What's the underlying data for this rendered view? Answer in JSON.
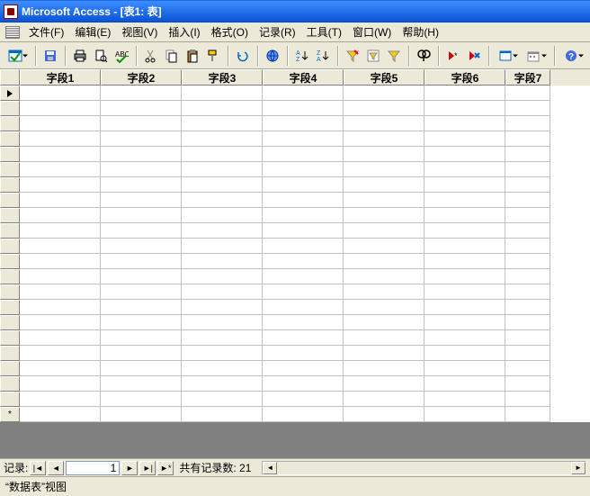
{
  "title": "Microsoft Access - [表1: 表]",
  "menu": {
    "file": "文件(F)",
    "edit": "编辑(E)",
    "view": "视图(V)",
    "insert": "插入(I)",
    "format": "格式(O)",
    "records": "记录(R)",
    "tools": "工具(T)",
    "window": "窗口(W)",
    "help": "帮助(H)"
  },
  "columns": [
    "字段1",
    "字段2",
    "字段3",
    "字段4",
    "字段5",
    "字段6",
    "字段7"
  ],
  "nav": {
    "label": "记录:",
    "current": "1",
    "total_label": "共有记录数:",
    "total": "21"
  },
  "status": "“数据表”视图"
}
